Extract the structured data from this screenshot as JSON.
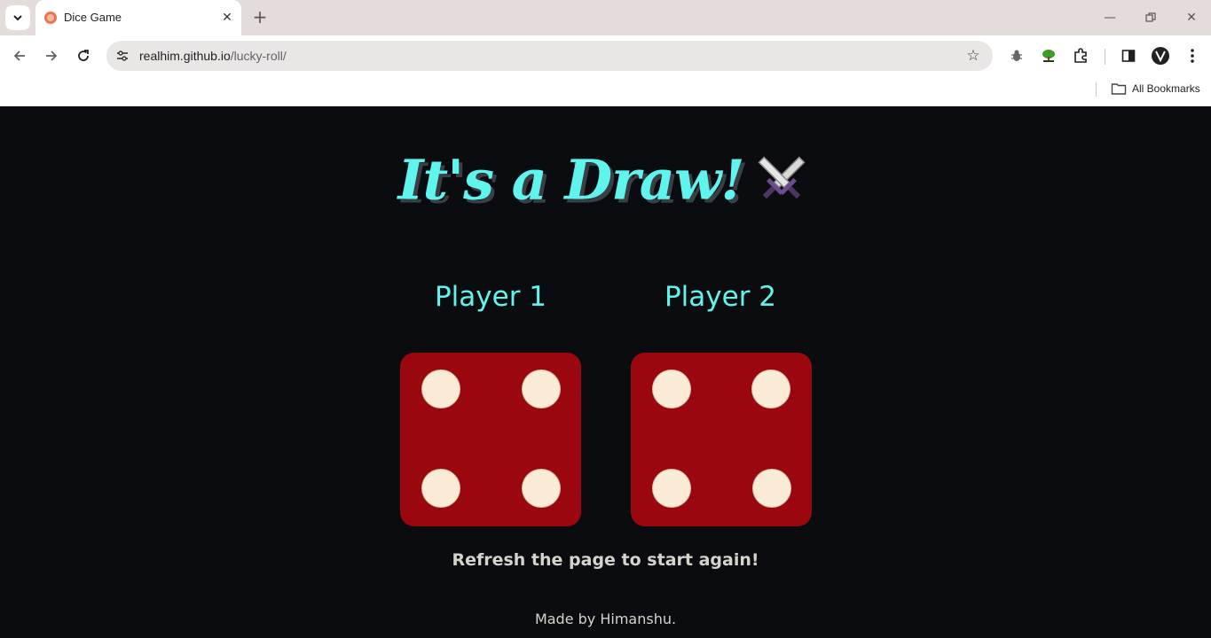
{
  "browser": {
    "tab_title": "Dice Game",
    "url_host": "realhim.github.io",
    "url_path": "/lucky-roll/",
    "bookmarks_label": "All Bookmarks"
  },
  "game": {
    "headline": "It's a Draw!",
    "headline_icon": "crossed-swords-icon",
    "players": [
      {
        "label": "Player 1",
        "die_value": 4
      },
      {
        "label": "Player 2",
        "die_value": 4
      }
    ],
    "refresh_text": "Refresh the page to start again!",
    "credit": "Made by Himanshu."
  },
  "colors": {
    "background": "#0b0c10",
    "accent": "#5ff5ee",
    "die": "#9b070f",
    "pip": "#faebd7"
  }
}
